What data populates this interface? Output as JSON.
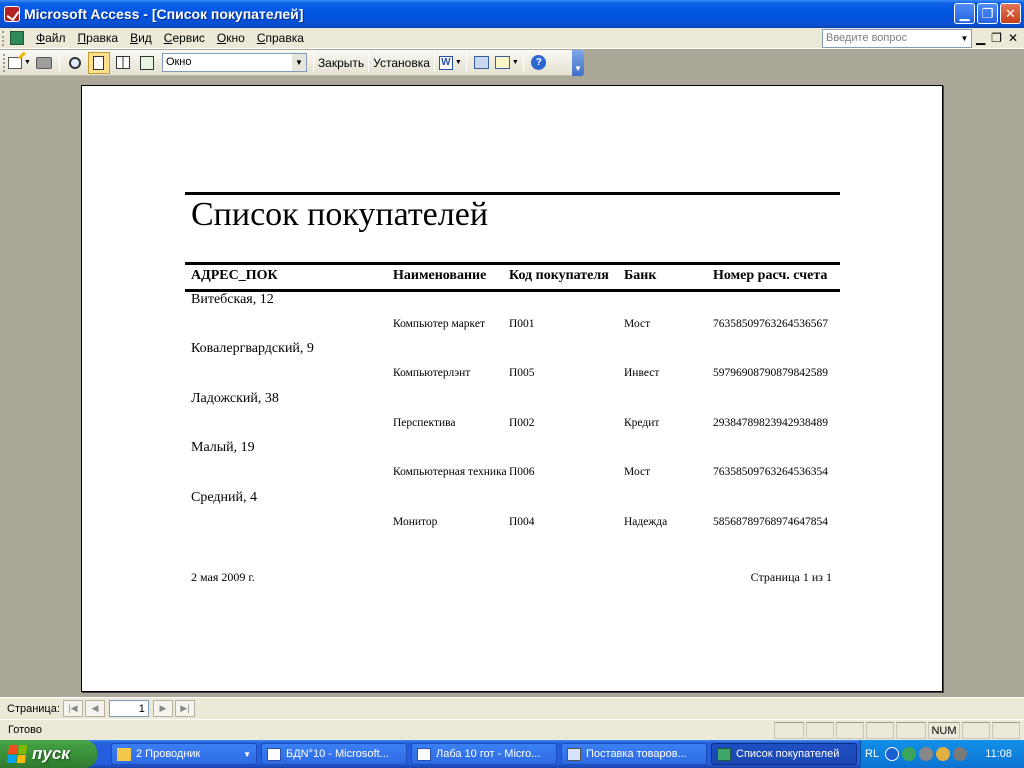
{
  "window": {
    "title": "Microsoft Access - [Список покупателей]"
  },
  "menu": {
    "items": [
      {
        "label": "Файл",
        "u": "Ф",
        "rest": "айл"
      },
      {
        "label": "Правка",
        "u": "П",
        "rest": "равка"
      },
      {
        "label": "Вид",
        "u": "В",
        "rest": "ид"
      },
      {
        "label": "Сервис",
        "u": "С",
        "rest": "ервис"
      },
      {
        "label": "Окно",
        "u": "О",
        "rest": "кно"
      },
      {
        "label": "Справка",
        "u": "С",
        "rest": "правка"
      }
    ],
    "help_placeholder": "Введите вопрос"
  },
  "toolbar": {
    "zoom_value": "Окно",
    "close_label": "Закрыть",
    "setup_label": "Установка",
    "word_icon_letter": "W",
    "help_icon_letter": "?"
  },
  "report": {
    "title": "Список покупателей",
    "headers": {
      "address": "АДРЕС_ПОК",
      "name": "Наименование",
      "code": "Код покупателя",
      "bank": "Банк",
      "account": "Номер расч. счета"
    },
    "groups": [
      {
        "address": "Витебская, 12",
        "name": "Компьютер маркет",
        "code": "П001",
        "bank": "Мост",
        "account": "76358509763264536567"
      },
      {
        "address": "Ковалергвардский, 9",
        "name": "Компьютерлэнт",
        "code": "П005",
        "bank": "Инвест",
        "account": "59796908790879842589"
      },
      {
        "address": "Ладожский, 38",
        "name": "Перспектива",
        "code": "П002",
        "bank": "Кредит",
        "account": "29384789823942938489"
      },
      {
        "address": "Малый, 19",
        "name": "Компьютерная техника",
        "code": "П006",
        "bank": "Мост",
        "account": "76358509763264536354"
      },
      {
        "address": "Средний, 4",
        "name": "Монитор",
        "code": "П004",
        "bank": "Надежда",
        "account": "58568789768974647854"
      }
    ],
    "date": "2 мая 2009 г.",
    "page_number": "Страница 1 из 1"
  },
  "navigation": {
    "label": "Страница:",
    "current_page": "1"
  },
  "status": {
    "text": "Готово",
    "num": "NUM"
  },
  "taskbar": {
    "start_label": "пуск",
    "tasks": [
      {
        "label": "2 Проводник",
        "color": "#F2C94C"
      },
      {
        "label": "БДN°10 - Microsoft...",
        "color": "#FFFFFF"
      },
      {
        "label": "Лаба 10 гот - Micro...",
        "color": "#FFFFFF"
      },
      {
        "label": "Поставка товаров...",
        "color": "#D8E4F8"
      },
      {
        "label": "Список покупателей",
        "color": "#3FA76B"
      }
    ],
    "lang": "RL",
    "clock": "11:08"
  },
  "colors": {
    "titlebar": "#0054E3",
    "workspace": "#ACA899",
    "chrome": "#ECE9D8",
    "taskbar": "#245EDC",
    "start": "#3B913B"
  }
}
